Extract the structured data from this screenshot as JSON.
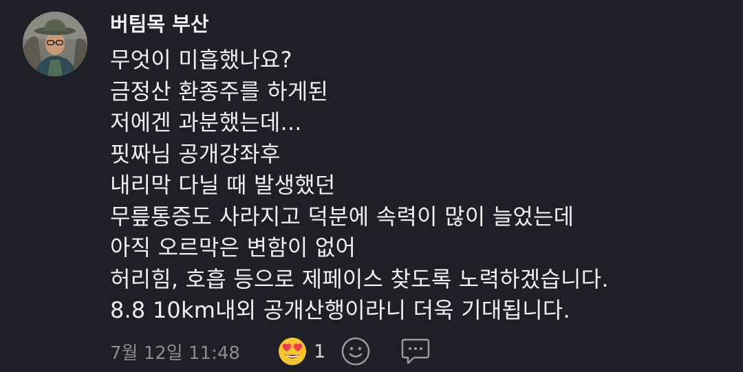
{
  "comment": {
    "author": "버팀목 부산",
    "lines": [
      "무엇이 미흡했나요?",
      "금정산 환종주를 하게된",
      "저에겐 과분했는데...",
      "핏짜님 공개강좌후",
      "내리막 다닐 때 발생했던",
      "무릎통증도 사라지고 덕분에 속력이 많이 늘었는데",
      "아직 오르막은 변함이 없어",
      "허리힘, 호흡 등으로 제페이스 찾도록 노력하겠습니다.",
      "8.8 10km내외 공개산행이라니 더욱 기대됩니다."
    ],
    "timestamp": "7월 12일 11:48",
    "reaction": {
      "icon": "heart-eyes-emoji-icon",
      "count": "1"
    },
    "actions": {
      "add_reaction_icon": "smiley-outline-icon",
      "reply_icon": "speech-bubble-icon"
    }
  },
  "colors": {
    "background": "#1f1f27",
    "text": "#f0f0f0",
    "meta": "#8b8b92",
    "emoji_face": "#f7c531",
    "heart": "#e8414a"
  }
}
